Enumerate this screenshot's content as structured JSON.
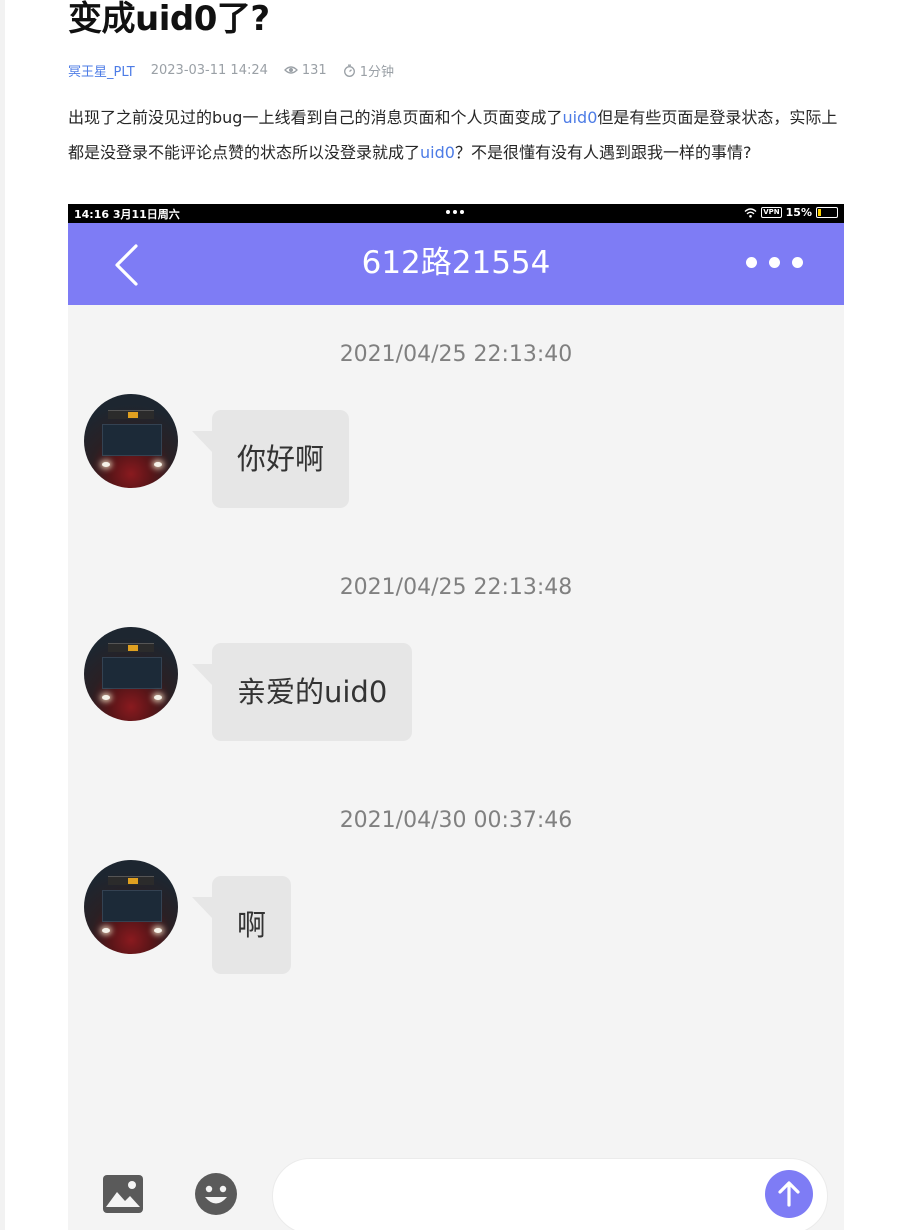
{
  "post": {
    "title": "变成uid0了?",
    "author": "冥王星_PLT",
    "date": "2023-03-11 14:24",
    "views": "131",
    "read_time": "1分钟",
    "icons": {
      "views": "eye-icon",
      "read_time": "timer-icon"
    },
    "body": {
      "seg1": "出现了之前没见过的bug一上线看到自己的消息页面和个人页面变成了",
      "link1": "uid0",
      "seg2": "但是有些页面是登录状态，实际上都是没登录不能评论点赞的状态所以没登录就成了",
      "link2": "uid0",
      "seg3": "？不是很懂有没有人遇到跟我一样的事情?"
    },
    "link_color": "#4d7ce6"
  },
  "screenshot": {
    "status_bar": {
      "time": "14:16  3月11日周六",
      "vpn": "VPN",
      "battery": "15%"
    },
    "nav": {
      "title": "612路21554",
      "back_icon": "chevron-left-icon",
      "more_icon": "more-dots-icon",
      "color": "#7e7cf5"
    },
    "messages": [
      {
        "timestamp": "2021/04/25 22:13:40",
        "text": "你好啊"
      },
      {
        "timestamp": "2021/04/25 22:13:48",
        "text": "亲爱的uid0"
      },
      {
        "timestamp": "2021/04/30 00:37:46",
        "text": "啊"
      }
    ],
    "composer": {
      "placeholder": "",
      "image_icon": "image-icon",
      "emoji_icon": "emoji-icon",
      "send_icon": "arrow-up-icon"
    }
  }
}
